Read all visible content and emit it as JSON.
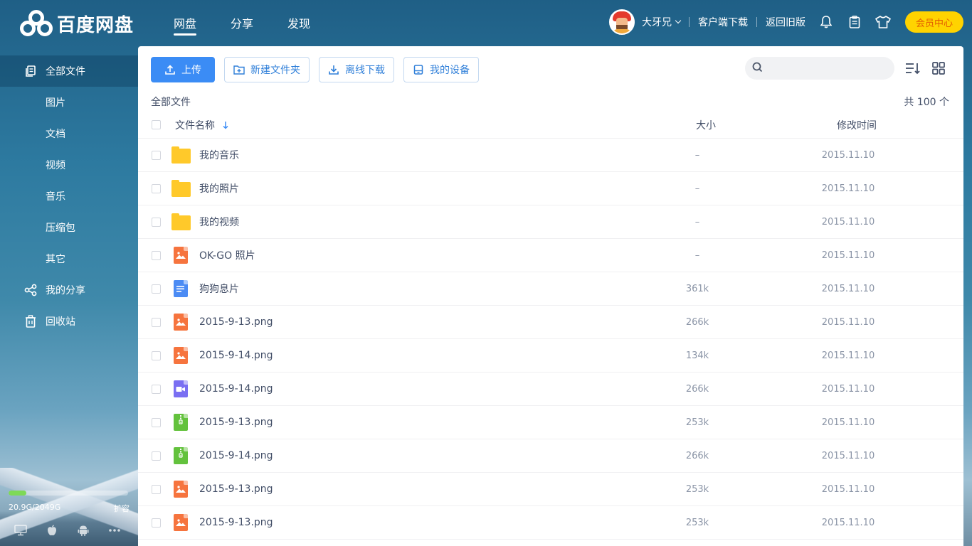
{
  "header": {
    "logo_text": "百度网盘",
    "nav": [
      {
        "label": "网盘",
        "active": true
      },
      {
        "label": "分享",
        "active": false
      },
      {
        "label": "发现",
        "active": false
      }
    ],
    "user_name": "大牙兄",
    "client_download": "客户端下载",
    "back_old": "返回旧版",
    "vip_label": "会员中心",
    "icons": [
      "bell-icon",
      "clipboard-icon",
      "tshirt-icon"
    ]
  },
  "sidebar": {
    "items": [
      {
        "label": "全部文件",
        "icon": "files-icon",
        "active": true
      },
      {
        "label": "图片",
        "sub": true
      },
      {
        "label": "文档",
        "sub": true
      },
      {
        "label": "视频",
        "sub": true
      },
      {
        "label": "音乐",
        "sub": true
      },
      {
        "label": "压缩包",
        "sub": true
      },
      {
        "label": "其它",
        "sub": true
      },
      {
        "label": "我的分享",
        "icon": "share-icon"
      },
      {
        "label": "回收站",
        "icon": "trash-icon"
      }
    ],
    "storage": {
      "used": "20.9G/2049G",
      "expand": "扩容",
      "used_fraction": 0.15
    },
    "device_icons": [
      "desktop-icon",
      "apple-icon",
      "android-icon",
      "more-icon"
    ]
  },
  "toolbar": {
    "upload": "上传",
    "new_folder": "新建文件夹",
    "offline_download": "离线下载",
    "my_devices": "我的设备",
    "search_placeholder": ""
  },
  "breadcrumb": "全部文件",
  "total": "共 100 个",
  "table": {
    "headers": {
      "name": "文件名称",
      "size": "大小",
      "time": "修改时间"
    },
    "rows": [
      {
        "type": "folder",
        "name": "我的音乐",
        "size": "–",
        "time": "2015.11.10"
      },
      {
        "type": "folder",
        "name": "我的照片",
        "size": "–",
        "time": "2015.11.10"
      },
      {
        "type": "folder",
        "name": "我的视频",
        "size": "–",
        "time": "2015.11.10"
      },
      {
        "type": "image",
        "name": "OK-GO 照片",
        "size": "–",
        "time": "2015.11.10"
      },
      {
        "type": "doc",
        "name": "狗狗息片",
        "size": "361k",
        "time": "2015.11.10"
      },
      {
        "type": "image",
        "name": "2015-9-13.png",
        "size": "266k",
        "time": "2015.11.10"
      },
      {
        "type": "image",
        "name": "2015-9-14.png",
        "size": "134k",
        "time": "2015.11.10"
      },
      {
        "type": "video",
        "name": "2015-9-14.png",
        "size": "266k",
        "time": "2015.11.10"
      },
      {
        "type": "zip",
        "name": "2015-9-13.png",
        "size": "253k",
        "time": "2015.11.10"
      },
      {
        "type": "zip",
        "name": "2015-9-14.png",
        "size": "266k",
        "time": "2015.11.10"
      },
      {
        "type": "image",
        "name": "2015-9-13.png",
        "size": "253k",
        "time": "2015.11.10"
      },
      {
        "type": "image",
        "name": "2015-9-13.png",
        "size": "253k",
        "time": "2015.11.10"
      }
    ]
  }
}
